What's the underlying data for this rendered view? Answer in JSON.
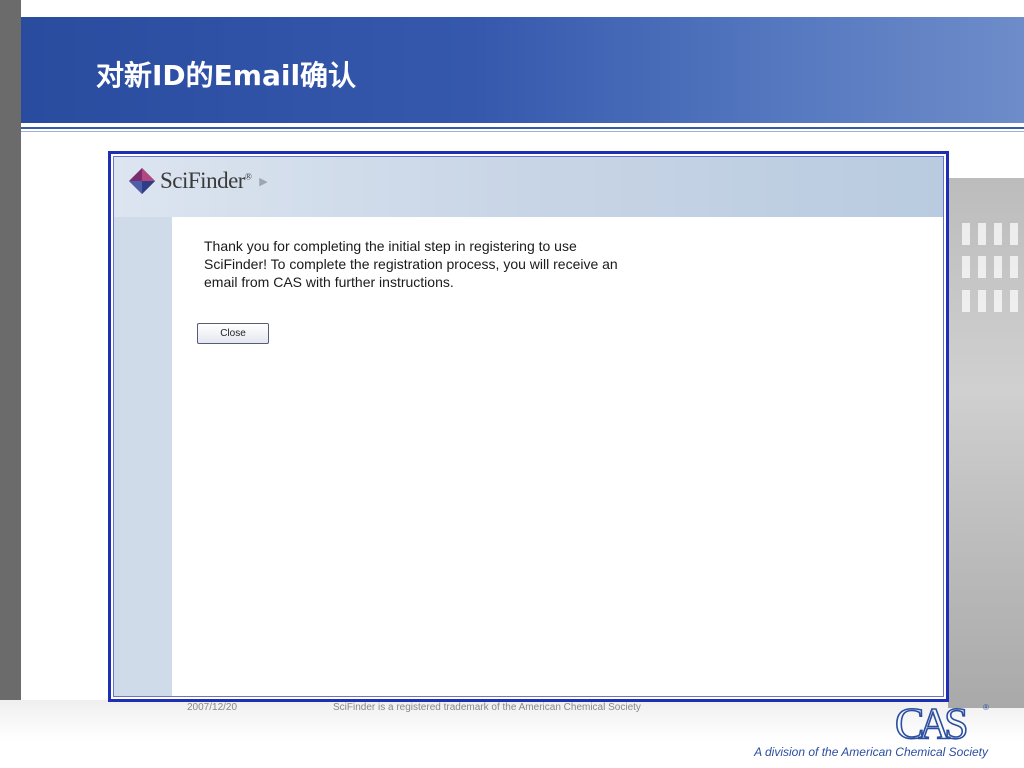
{
  "slide": {
    "title": "对新ID的Email确认",
    "tagline": "A division of the American Chemical Society",
    "footer": {
      "date": "2007/12/20",
      "trademark": "SciFinder is a registered trademark of the American Chemical Society"
    }
  },
  "app": {
    "logo_text": "SciFinder",
    "logo_mark": "®",
    "message": "Thank you for completing the initial step in registering to use SciFinder! To complete the registration process, you will receive an email from CAS with further instructions.",
    "close_label": "Close"
  },
  "cas_logo": {
    "letters": "CAS",
    "mark": "®"
  },
  "colors": {
    "title_band": "#2a4c9f",
    "screenshot_border": "#1f2fb5",
    "tagline": "#2b4ea0"
  },
  "icons": [
    "scifinder-logo-icon",
    "arrow-right-icon",
    "cas-logo-icon"
  ]
}
